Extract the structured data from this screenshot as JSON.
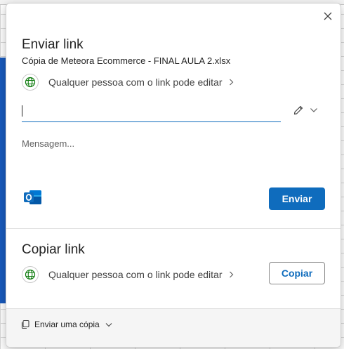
{
  "send_link": {
    "title": "Enviar link",
    "file_name": "Cópia de Meteora Ecommerce - FINAL AULA 2.xlsx",
    "permission": "Qualquer pessoa com o link pode editar",
    "to_value": "",
    "message_placeholder": "Mensagem...",
    "send_button": "Enviar"
  },
  "copy_link": {
    "title": "Copiar link",
    "permission": "Qualquer pessoa com o link pode editar",
    "copy_button": "Copiar"
  },
  "footer": {
    "send_copy": "Enviar uma cópia"
  },
  "icons": {
    "close": "close-icon",
    "globe": "globe-icon",
    "pencil": "pencil-icon",
    "outlook": "outlook-icon",
    "copy": "copy-icon"
  },
  "colors": {
    "accent": "#0f6cbd",
    "globe": "#107c10"
  }
}
